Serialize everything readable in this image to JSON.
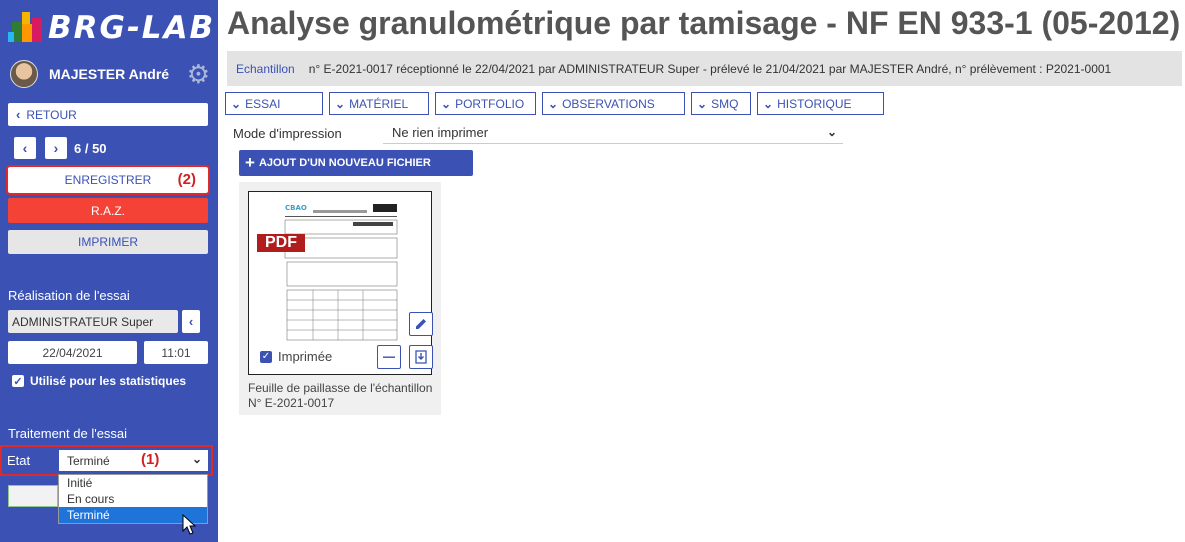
{
  "app": {
    "logo_text": "BRG-LAB",
    "user_name": "MAJESTER André",
    "page_title": "Analyse granulométrique par tamisage - NF EN 933-1 (05-2012)"
  },
  "sidebar": {
    "retour_label": "RETOUR",
    "pager": "6 / 50",
    "save_label": "ENREGISTRER",
    "save_annotation": "(2)",
    "raz_label": "R.A.Z.",
    "print_label": "IMPRIMER",
    "realisation_title": "Réalisation de l'essai",
    "operator": "ADMINISTRATEUR Super",
    "date": "22/04/2021",
    "time": "11:01",
    "stats_label": "Utilisé pour les statistiques",
    "stats_checked": true,
    "traitement_title": "Traitement de l'essai",
    "etat_label": "Etat",
    "etat_value": "Terminé",
    "etat_annotation": "(1)",
    "etat_options": [
      "Initié",
      "En cours",
      "Terminé"
    ],
    "etat_selected_index": 2
  },
  "sample_bar": {
    "label": "Echantillon",
    "text": "n° E-2021-0017 réceptionné le 22/04/2021 par ADMINISTRATEUR Super - prélevé le 21/04/2021 par MAJESTER André, n° prélèvement : P2021-0001"
  },
  "tabs": [
    {
      "label": "ESSAI"
    },
    {
      "label": "MATÉRIEL"
    },
    {
      "label": "PORTFOLIO"
    },
    {
      "label": "OBSERVATIONS"
    },
    {
      "label": "SMQ"
    },
    {
      "label": "HISTORIQUE"
    }
  ],
  "print_mode": {
    "label": "Mode d'impression",
    "value": "Ne rien imprimer"
  },
  "add_file_label": "AJOUT D'UN NOUVEAU FICHIER",
  "file_card": {
    "badge": "PDF",
    "doc_logo": "CBAO",
    "printed_label": "Imprimée",
    "printed_checked": true,
    "caption": "Feuille de paillasse de l'échantillon N° E-2021-0017"
  },
  "colors": {
    "primary": "#3b52b4",
    "danger": "#f44336",
    "annotation": "#d32020",
    "pdf_badge": "#b11c1c"
  }
}
